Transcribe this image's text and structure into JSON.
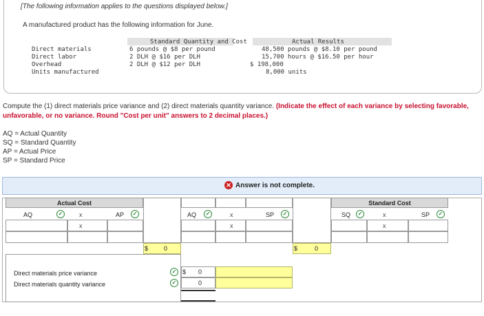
{
  "header": {
    "italic_note": "[The following information applies to the questions displayed below.]",
    "intro": "A manufactured product has the following information for June."
  },
  "data_table": {
    "col_standard": "Standard Quantity and Cost",
    "col_actual": "Actual Results",
    "rows": [
      {
        "label": "Direct materials",
        "standard": "6 pounds @ $8 per pound",
        "actual": "48,500 pounds @ $8.10 per pound"
      },
      {
        "label": "Direct labor",
        "standard": "2 DLH @ $16 per DLH",
        "actual": "15,700 hours @ $16.50 per hour"
      },
      {
        "label": "Overhead",
        "standard": "2 DLH @ $12 per DLH",
        "actual": "$ 198,000"
      },
      {
        "label": "Units manufactured",
        "standard": "",
        "actual": "8,000 units"
      }
    ]
  },
  "question": {
    "text": "Compute the (1) direct materials price variance and (2) direct materials quantity variance. ",
    "instruction": "(Indicate the effect of each variance by selecting favorable, unfavorable, or no variance. Round \"Cost per unit\" answers to 2 decimal places.)"
  },
  "legend": [
    "AQ = Actual Quantity",
    "SQ = Standard Quantity",
    "AP = Actual Price",
    "SP = Standard Price"
  ],
  "answer": {
    "status": "Answer is not complete.",
    "actual_cost_header": "Actual Cost",
    "standard_cost_header": "Standard Cost",
    "labels": {
      "aq": "AQ",
      "ap": "AP",
      "sp": "SP",
      "sq": "SQ"
    },
    "times": "x",
    "dollar": "$",
    "total_actual": "0",
    "total_standard": "0",
    "price_variance_label": "Direct materials price variance",
    "quantity_variance_label": "Direct materials quantity variance",
    "price_variance_value": "0",
    "quantity_variance_value": "0"
  },
  "colors": {
    "accent_red": "#c8102e",
    "check_green": "#2e8b3a",
    "banner_blue": "#e3edf9",
    "input_yellow": "#ffff9c"
  }
}
